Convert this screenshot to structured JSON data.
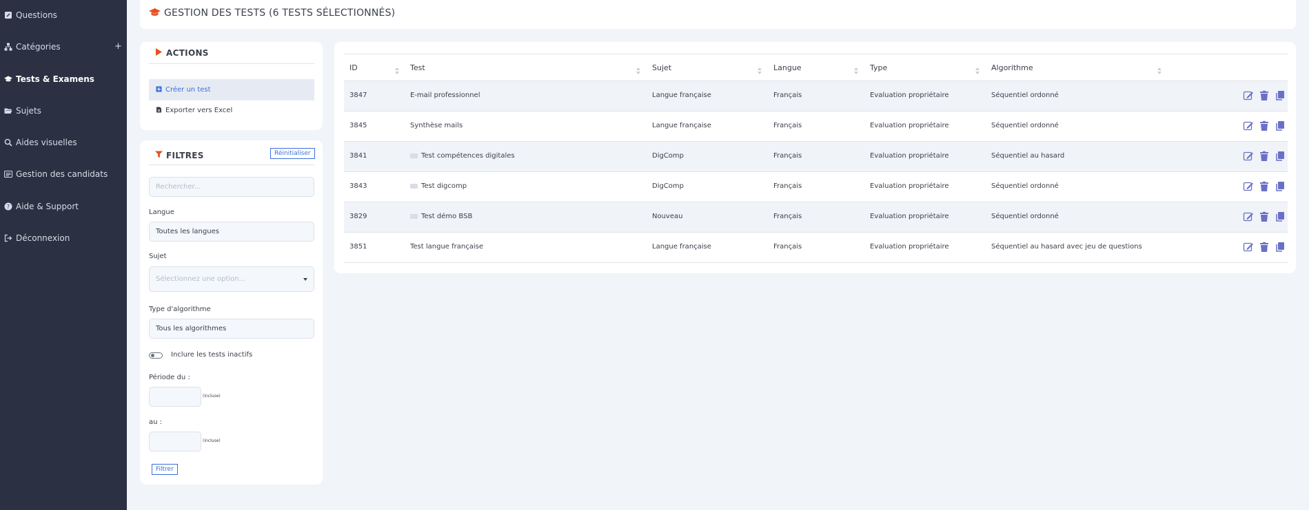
{
  "sidebar": {
    "items": [
      {
        "label": "Questions",
        "icon": "edit-icon"
      },
      {
        "label": "Catégories",
        "icon": "sitemap-icon"
      },
      {
        "label": "Tests & Examens",
        "icon": "graduation-cap-icon"
      },
      {
        "label": "Sujets",
        "icon": "folder-open-icon"
      },
      {
        "label": "Aides visuelles",
        "icon": "search-icon"
      },
      {
        "label": "Gestion des candidats",
        "icon": "id-card-icon"
      },
      {
        "label": "Aide & Support",
        "icon": "question-circle-icon"
      },
      {
        "label": "Déconnexion",
        "icon": "sign-out-icon"
      }
    ],
    "add_label": "+",
    "active_index": 2
  },
  "header": {
    "title": "GESTION DES TESTS (6 TESTS SÉLECTIONNÉS)"
  },
  "actions": {
    "title": "ACTIONS",
    "items": [
      {
        "label": "Créer un test"
      },
      {
        "label": "Exporter vers Excel"
      }
    ]
  },
  "filters": {
    "title": "FILTRES",
    "reset_label": "Réinitialiser",
    "search_placeholder": "Rechercher...",
    "langue_label": "Langue",
    "langue_value": "Toutes les langues",
    "sujet_label": "Sujet",
    "sujet_placeholder": "Sélectionnez une option...",
    "algo_label": "Type d'algorithme",
    "algo_value": "Tous les algorithmes",
    "inactive_label": "Inclure les tests inactifs",
    "periode_label": "Période du :",
    "au_label": "au :",
    "incluse_label": "(incluse)",
    "submit_label": "Filtrer"
  },
  "table": {
    "headers": [
      "ID",
      "Test",
      "Sujet",
      "Langue",
      "Type",
      "Algorithme"
    ],
    "rows": [
      {
        "id": "3847",
        "test": "E-mail professionnel",
        "thumb": false,
        "sujet": "Langue française",
        "langue": "Français",
        "type": "Evaluation propriétaire",
        "algo": "Séquentiel ordonné"
      },
      {
        "id": "3845",
        "test": "Synthèse mails",
        "thumb": false,
        "sujet": "Langue française",
        "langue": "Français",
        "type": "Evaluation propriétaire",
        "algo": "Séquentiel ordonné"
      },
      {
        "id": "3841",
        "test": "Test compétences digitales",
        "thumb": true,
        "sujet": "DigComp",
        "langue": "Français",
        "type": "Evaluation propriétaire",
        "algo": "Séquentiel au hasard"
      },
      {
        "id": "3843",
        "test": "Test digcomp",
        "thumb": true,
        "sujet": "DigComp",
        "langue": "Français",
        "type": "Evaluation propriétaire",
        "algo": "Séquentiel ordonné"
      },
      {
        "id": "3829",
        "test": "Test démo BSB",
        "thumb": true,
        "sujet": "Nouveau",
        "langue": "Français",
        "type": "Evaluation propriétaire",
        "algo": "Séquentiel ordonné"
      },
      {
        "id": "3851",
        "test": "Test langue française",
        "thumb": false,
        "sujet": "Langue française",
        "langue": "Français",
        "type": "Evaluation propriétaire",
        "algo": "Séquentiel au hasard avec jeu de questions"
      }
    ],
    "row_action_icons": [
      "edit-icon",
      "trash-icon",
      "copy-icon"
    ]
  },
  "colors": {
    "sidebar_bg": "#2b3142",
    "accent": "#3a6fd8",
    "brand_orange": "#e8501f",
    "icon_purple": "#6a6fc6"
  }
}
